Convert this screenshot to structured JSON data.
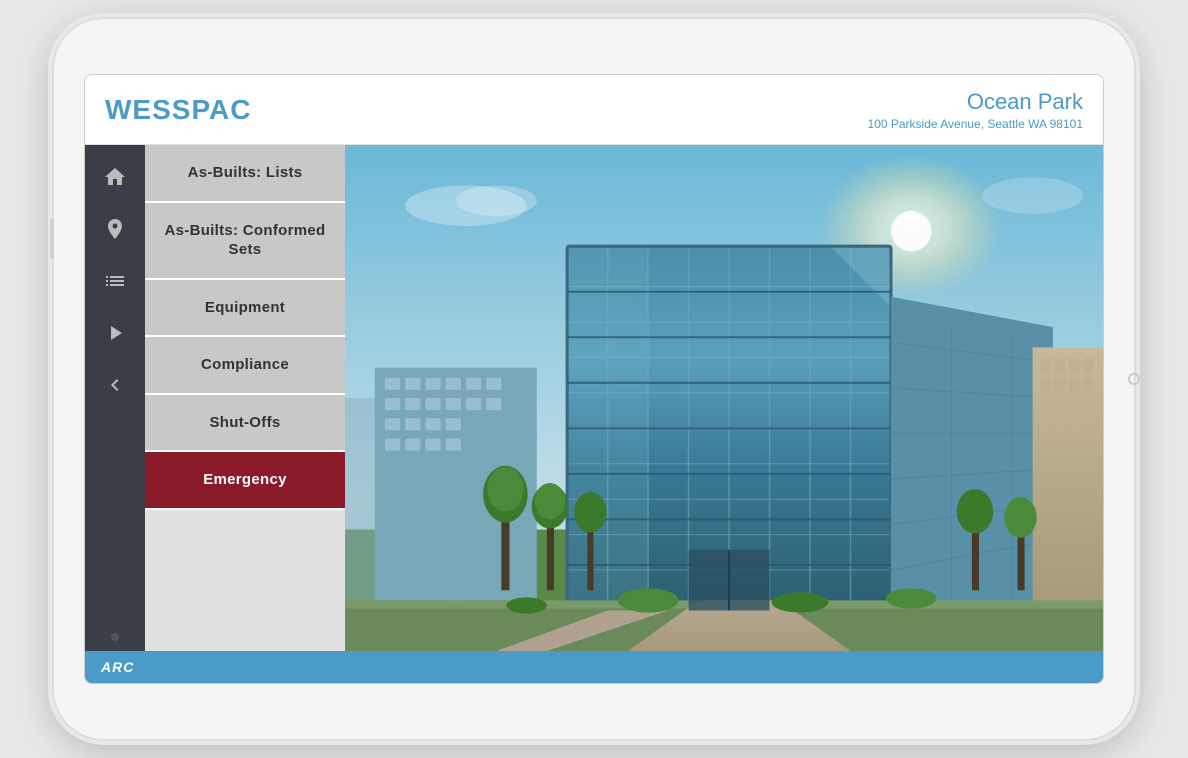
{
  "app": {
    "logo": "WESSPAC",
    "footer_logo": "ARC"
  },
  "property": {
    "name": "Ocean Park",
    "address": "100 Parkside Avenue, Seattle WA 98101"
  },
  "sidebar": {
    "icons": [
      {
        "name": "home-icon",
        "symbol": "home"
      },
      {
        "name": "location-icon",
        "symbol": "location"
      },
      {
        "name": "list-icon",
        "symbol": "list"
      },
      {
        "name": "play-icon",
        "symbol": "play"
      },
      {
        "name": "back-icon",
        "symbol": "back"
      }
    ]
  },
  "menu": {
    "items": [
      {
        "id": "as-builts-lists",
        "label": "As-Builts: Lists",
        "active": false
      },
      {
        "id": "as-builts-conformed",
        "label": "As-Builts: Conformed Sets",
        "active": false
      },
      {
        "id": "equipment",
        "label": "Equipment",
        "active": false
      },
      {
        "id": "compliance",
        "label": "Compliance",
        "active": false
      },
      {
        "id": "shut-offs",
        "label": "Shut-Offs",
        "active": false
      },
      {
        "id": "emergency",
        "label": "Emergency",
        "active": true
      }
    ]
  },
  "colors": {
    "brand_blue": "#4a9bc7",
    "sidebar_bg": "#3a3f47",
    "menu_bg": "#c8c8c8",
    "emergency_red": "#8b1a2a",
    "footer_blue": "#4a9bc7"
  }
}
